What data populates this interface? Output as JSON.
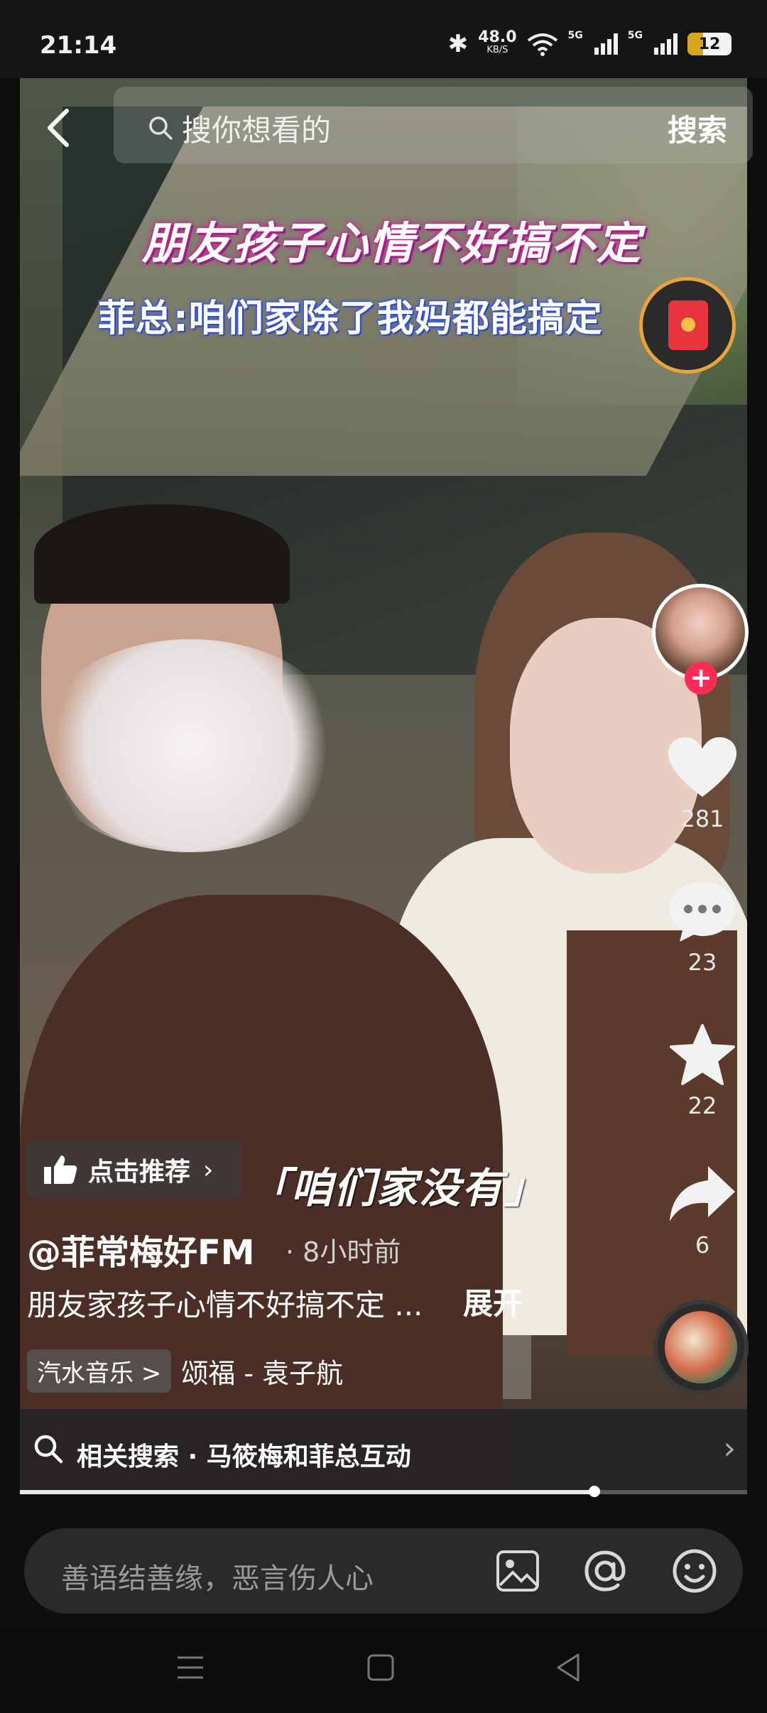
{
  "status_bar": {
    "time": "21:14",
    "speed_value": "48.0",
    "speed_unit": "KB/S",
    "net1": "5G",
    "net2": "5G",
    "battery": "12"
  },
  "search": {
    "placeholder": "搜你想看的",
    "button": "搜索"
  },
  "captions": {
    "title": "朋友孩子心情不好搞不定",
    "line2": "菲总:咱们家除了我妈都能搞定",
    "subtitle": "「咱们家没有」"
  },
  "actions": {
    "likes": "281",
    "comments": "23",
    "favorites": "22",
    "shares": "6"
  },
  "video_info": {
    "recommend_label": "点击推荐",
    "author": "@菲常梅好FM",
    "time_ago": "· 8小时前",
    "description": "朋友家孩子心情不好搞不定 ...",
    "expand": "展开",
    "music_tag": "汽水音乐 >",
    "song": "颂福 - 袁子航"
  },
  "related_search": {
    "label": "相关搜索 · 马筱梅和菲总互动"
  },
  "playback": {
    "progress": 0.79
  },
  "comment_bar": {
    "placeholder": "善语结善缘，恶言伤人心"
  },
  "colors": {
    "follow_red": "#fe2c55",
    "background": "#0e0e0e"
  }
}
